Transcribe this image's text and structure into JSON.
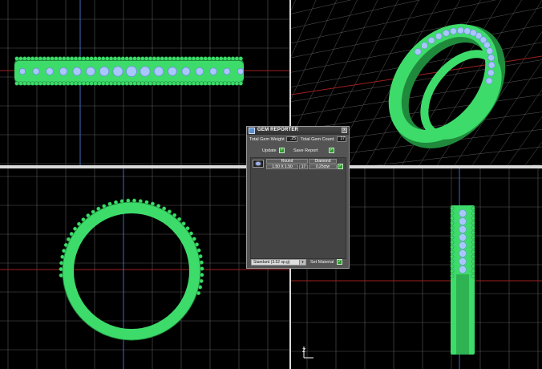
{
  "panel": {
    "title": "GEM REPORTER",
    "close_label": "x",
    "total_weight_label": "Total Gem Weight",
    "total_weight_value": ".25",
    "total_count_label": "Total Gem Count",
    "total_count_value": "17",
    "update_label": "Update",
    "save_report_label": "Save Report",
    "check_mark": "✓",
    "columns": [
      "Round",
      "Diamond"
    ],
    "row": {
      "size": "1.50 X 1.50",
      "count": "17",
      "weight": "0.25ctw"
    },
    "dropdown_value": "Standard   (3.52 sp.g)",
    "set_material_label": "Set Material"
  },
  "viewports": [
    "top",
    "perspective",
    "front",
    "right"
  ],
  "axis_label": "Z",
  "colors": {
    "metal": "#3ddc6a",
    "metal_dark": "#1f8a3c",
    "gem": "#a9c6ff",
    "grid": "#5a5a5a",
    "grid_major": "#8a8a8a",
    "axis_red": "#a02020",
    "axis_blue": "#3c6cc0",
    "divider": "#d9d9d9",
    "panel_bg": "#545454"
  },
  "icons": [
    "gem-reporter-app-icon",
    "close-icon",
    "checkbox-icon",
    "dropdown-arrow-icon",
    "gem-thumbnail-icon"
  ]
}
